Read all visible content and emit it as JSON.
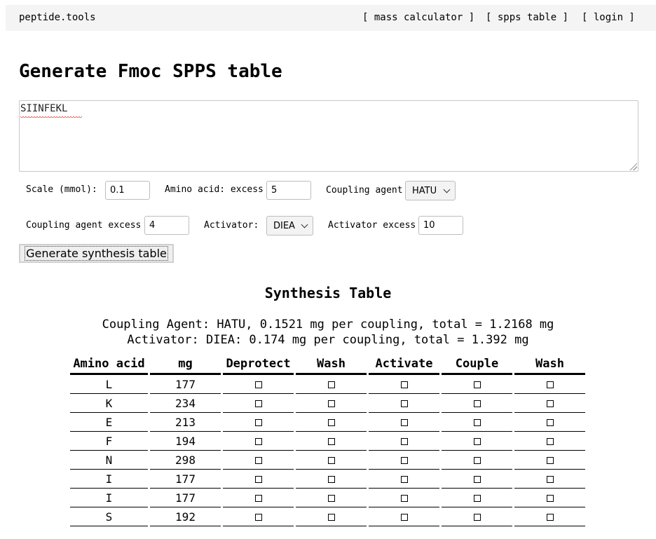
{
  "nav": {
    "brand": "peptide.tools",
    "links": [
      "[ mass calculator ]",
      "[ spps table ]",
      "[ login ]"
    ]
  },
  "page_title": "Generate Fmoc SPPS table",
  "sequence": "SIINFEKL",
  "form": {
    "scale_label": "Scale (mmol):",
    "scale_value": "0.1",
    "aa_excess_label": "Amino acid: excess",
    "aa_excess_value": "5",
    "coupling_agent_label": "Coupling agent",
    "coupling_agent_value": "HATU",
    "coupling_excess_label": "Coupling agent excess",
    "coupling_excess_value": "4",
    "activator_label": "Activator:",
    "activator_value": "DIEA",
    "activator_excess_label": "Activator excess",
    "activator_excess_value": "10",
    "generate_label": "Generate synthesis table"
  },
  "synthesis": {
    "title": "Synthesis Table",
    "coupling_summary": "Coupling Agent: HATU, 0.1521 mg per coupling, total = 1.2168 mg",
    "activator_summary": "Activator: DIEA: 0.174 mg per coupling, total = 1.392 mg",
    "columns": [
      "Amino acid",
      "mg",
      "Deprotect",
      "Wash",
      "Activate",
      "Couple",
      "Wash"
    ],
    "rows": [
      {
        "aa": "L",
        "mg": "177"
      },
      {
        "aa": "K",
        "mg": "234"
      },
      {
        "aa": "E",
        "mg": "213"
      },
      {
        "aa": "F",
        "mg": "194"
      },
      {
        "aa": "N",
        "mg": "298"
      },
      {
        "aa": "I",
        "mg": "177"
      },
      {
        "aa": "I",
        "mg": "177"
      },
      {
        "aa": "S",
        "mg": "192"
      }
    ]
  }
}
